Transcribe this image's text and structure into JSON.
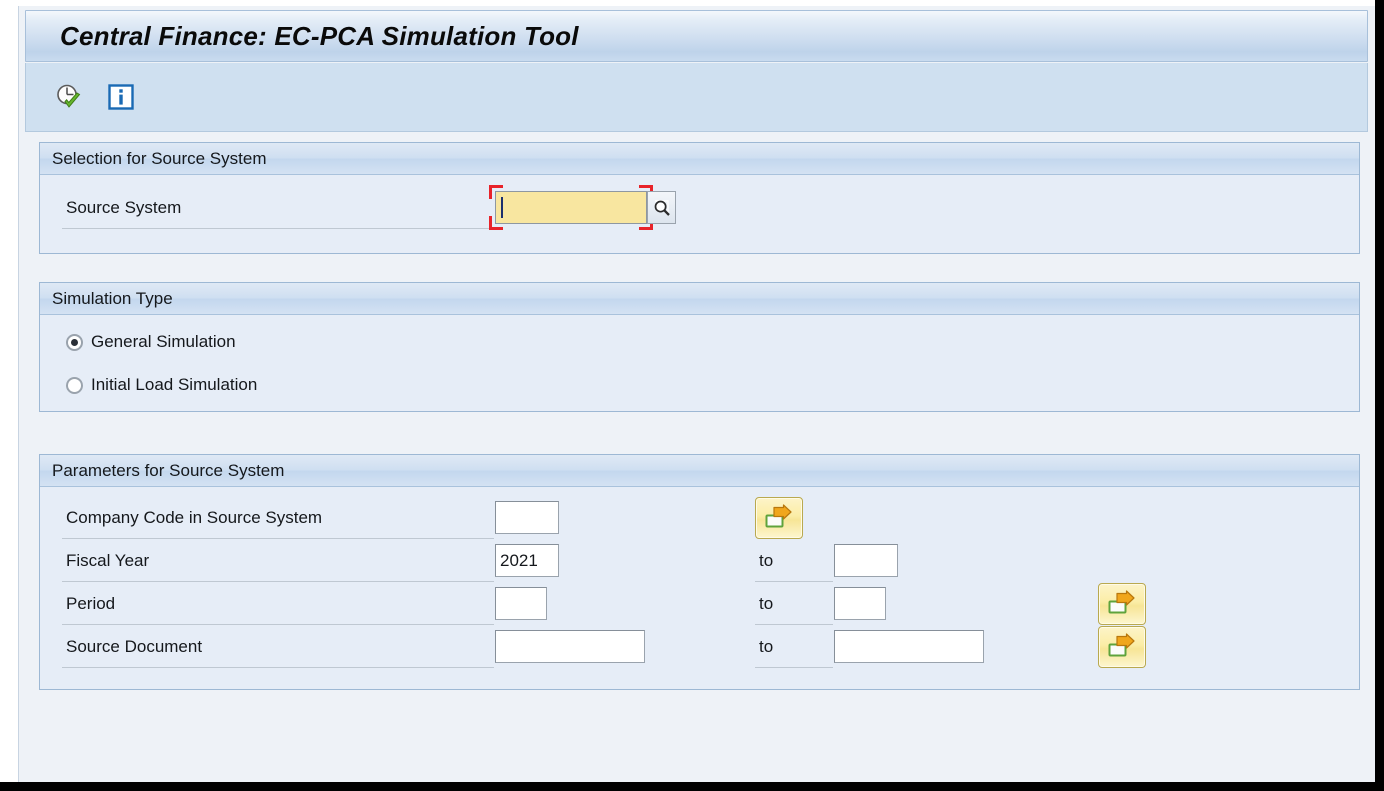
{
  "window": {
    "title": "Central Finance: EC-PCA Simulation Tool"
  },
  "toolbar": {
    "items": [
      {
        "name": "execute-check-icon",
        "label": "Execute"
      },
      {
        "name": "info-icon",
        "label": "Information"
      }
    ]
  },
  "groups": {
    "selection_source_system": {
      "title": "Selection for Source System",
      "fields": {
        "source_system": {
          "label": "Source System",
          "value": "",
          "placeholder": "",
          "required": true,
          "focused": true,
          "has_search_help": true
        }
      }
    },
    "simulation_type": {
      "title": "Simulation Type",
      "options": [
        {
          "label": "General Simulation",
          "selected": true
        },
        {
          "label": "Initial Load Simulation",
          "selected": false
        }
      ]
    },
    "parameters_source_system": {
      "title": "Parameters for Source System",
      "to_label": "to",
      "rows": [
        {
          "label": "Company Code in Source System",
          "from_value": "",
          "to_value": null,
          "has_to": false,
          "multi_select": true
        },
        {
          "label": "Fiscal Year",
          "from_value": "2021",
          "to_value": "",
          "has_to": true,
          "multi_select": false
        },
        {
          "label": "Period",
          "from_value": "",
          "to_value": "",
          "has_to": true,
          "multi_select": true
        },
        {
          "label": "Source Document",
          "from_value": "",
          "to_value": "",
          "has_to": true,
          "multi_select": true
        }
      ]
    }
  },
  "colors": {
    "title_bar_accent": "#bed3ea",
    "toolbar_bg": "#cfe0f0",
    "group_bg": "#e6edf7",
    "required_field": "#f8e6a0",
    "focus_bracket": "#e8232a",
    "multiselect_button": "#fbeda6"
  }
}
